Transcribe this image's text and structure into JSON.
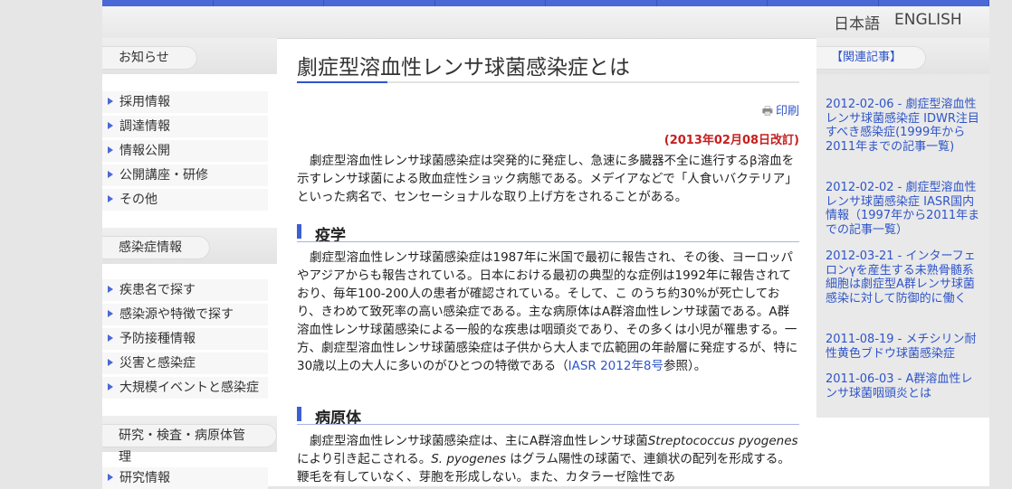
{
  "language": {
    "japanese": "日本語",
    "english": "ENGLISH"
  },
  "sidebar": {
    "news_title": "お知らせ",
    "news_items": [
      "採用情報",
      "調達情報",
      "情報公開",
      "公開講座・研修",
      "その他"
    ],
    "disease_title": "感染症情報",
    "disease_items": [
      "疾患名で探す",
      "感染源や特徴で探す",
      "予防接種情報",
      "災害と感染症",
      "大規模イベントと感染症"
    ],
    "research_title": "研究・検査・病原体管理",
    "research_items": [
      "研究情報"
    ]
  },
  "article": {
    "title": "劇症型溶血性レンサ球菌感染症とは",
    "print_label": "印刷",
    "revised": "(2013年02月08日改訂)",
    "intro": "劇症型溶血性レンサ球菌感染症は突発的に発症し、急速に多臓器不全に進行するβ溶血を示すレンサ球菌による敗血症性ショック病態である。メデイアなどで「人食いバクテリア」といった病名で、センセーショナルな取り上げ方をされることがある。",
    "epi_heading": "疫学",
    "epi_text": "劇症型溶血性レンサ球菌感染症は1987年に米国で最初に報告され、その後、ヨーロッパやアジアからも報告されている。日本における最初の典型的な症例は1992年に報告されており、毎年100-200人の患者が確認されている。そして、こ のうち約30%が死亡しており、きわめて致死率の高い感染症である。主な病原体はA群溶血性レンサ球菌である。A群溶血性レンサ球菌感染による一般的な疾患は咽頭炎であり、その多くは小児が罹患する。一方、劇症型溶血性レンサ球菌感染症は子供から大人まで広範囲の年齢層に発症するが、特に30歳以上の大人に多いのがひとつの特徴である（",
    "epi_link": "IASR 2012年8号",
    "epi_after": "参照）。",
    "path_heading": "病原体",
    "path_text_a": "劇症型溶血性レンサ球菌感染症は、主にA群溶血性レンサ球菌",
    "path_species": "Streptococcus pyogenes",
    "path_text_b": "により引き起こされる。",
    "path_species_short": "S. pyogenes",
    "path_text_c": "はグラム陽性の球菌で、連鎖状の配列を形成する。鞭毛を有していなく、芽胞を形成しない。また、カタラーゼ陰性であ"
  },
  "related": {
    "title": "【関連記事】",
    "items": [
      "2012-02-06 - 劇症型溶血性レンサ球菌感染症 IDWR注目すべき感染症(1999年から2011年までの記事一覧)",
      "2012-02-02 - 劇症型溶血性レンサ球菌感染症 IASR国内情報（1997年から2011年までの記事一覧）",
      "2012-03-21 - インターフェロンγを産生する未熟骨髄系細胞は劇症型A群レンサ球菌感染に対して防御的に働く",
      "2011-08-19 - メチシリン耐性黄色ブドウ球菌感染症",
      "2011-06-03 - A群溶血性レンサ球菌咽頭炎とは"
    ]
  },
  "colors": {
    "accent": "#4a68d6",
    "link": "#2f55c8",
    "revised": "#c62020"
  },
  "icons": {
    "print": "printer-icon",
    "bullet": "triangle-right-icon"
  }
}
